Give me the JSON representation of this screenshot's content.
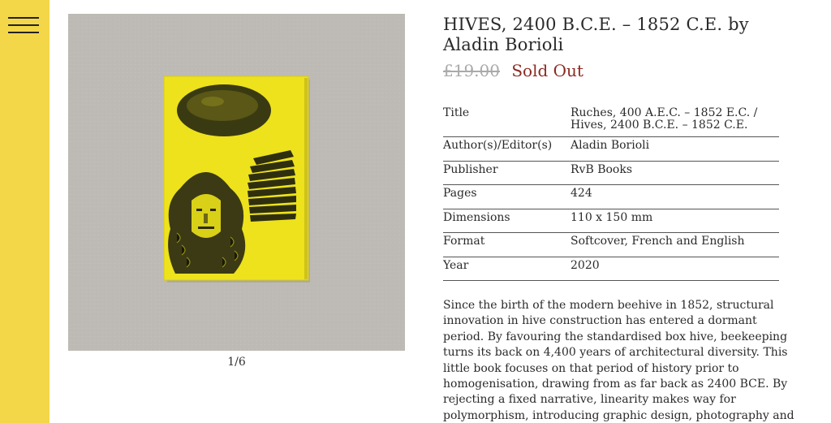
{
  "nav": {
    "menu_icon": "hamburger-icon"
  },
  "gallery": {
    "counter": "1/6"
  },
  "product": {
    "title": "HIVES, 2400 B.C.E. – 1852 C.E. by Aladin Borioli",
    "price": "£19.00",
    "status": "Sold Out"
  },
  "specs": [
    {
      "label": "Title",
      "value": "Ruches, 400 A.E.C. – 1852 E.C. / Hives, 2400 B.C.E. – 1852 C.E."
    },
    {
      "label": "Author(s)/Editor(s)",
      "value": "Aladin Borioli"
    },
    {
      "label": "Publisher",
      "value": "RvB Books"
    },
    {
      "label": "Pages",
      "value": "424"
    },
    {
      "label": "Dimensions",
      "value": "110 x 150 mm"
    },
    {
      "label": "Format",
      "value": "Softcover, French and English"
    },
    {
      "label": "Year",
      "value": "2020"
    }
  ],
  "description": "Since the birth of the modern beehive in 1852, structural innovation in hive construction has entered a dormant period. By favouring the standardised box hive, beekeeping turns its back on 4,400 years of architectural diversity. This little book focuses on that period of history prior to homogenisation, drawing from as far back as 2400 BCE. By rejecting a fixed narrative, linearity makes way for polymorphism, introducing graphic design, photography and",
  "colors": {
    "sidebar": "#f3d749",
    "sold_out": "#8c2b22",
    "book_cover": "#ede21c"
  }
}
